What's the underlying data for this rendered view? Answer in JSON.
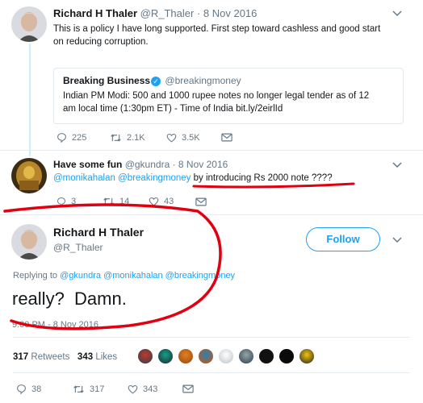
{
  "tweet1": {
    "name": "Richard H Thaler",
    "handle": "@R_Thaler",
    "date": "· 8 Nov 2016",
    "text_line1": "This is a policy I have long supported. First step toward cashless and good start",
    "text_line2": "on reducing corruption.",
    "quote": {
      "name": "Breaking Business",
      "handle": "@breakingmoney",
      "text_line1": "Indian PM Modi: 500 and 1000 rupee notes no longer legal tender as of 12",
      "text_line2": "am local time (1:30pm ET) - Time of India bit.ly/2eirlId"
    },
    "replies": "225",
    "retweets": "2.1K",
    "likes": "3.5K"
  },
  "tweet2": {
    "name": "Have some fun",
    "handle": "@gkundra",
    "date": "· 8 Nov 2016",
    "mention1": "@monikahalan",
    "mention2": "@breakingmoney",
    "text": "by introducing Rs 2000 note ????",
    "replies": "3",
    "retweets": "14",
    "likes": "43"
  },
  "main": {
    "name": "Richard H Thaler",
    "handle": "@R_Thaler",
    "follow_label": "Follow",
    "replying_prefix": "Replying to",
    "replying_to": "@gkundra @monikahalan @breakingmoney",
    "text": "really?  Damn.",
    "timestamp": "9:00 PM - 8 Nov 2016",
    "retweets_count": "317",
    "retweets_label": "Retweets",
    "likes_count": "343",
    "likes_label": "Likes",
    "action_replies": "38",
    "action_retweets": "317",
    "action_likes": "343"
  },
  "colors": {
    "accent": "#1da1f2",
    "annotation": "#e0000f",
    "muted": "#657786"
  },
  "icons": [
    "chevron-down-icon",
    "reply-icon",
    "retweet-icon",
    "heart-icon",
    "message-icon",
    "verified-icon"
  ]
}
